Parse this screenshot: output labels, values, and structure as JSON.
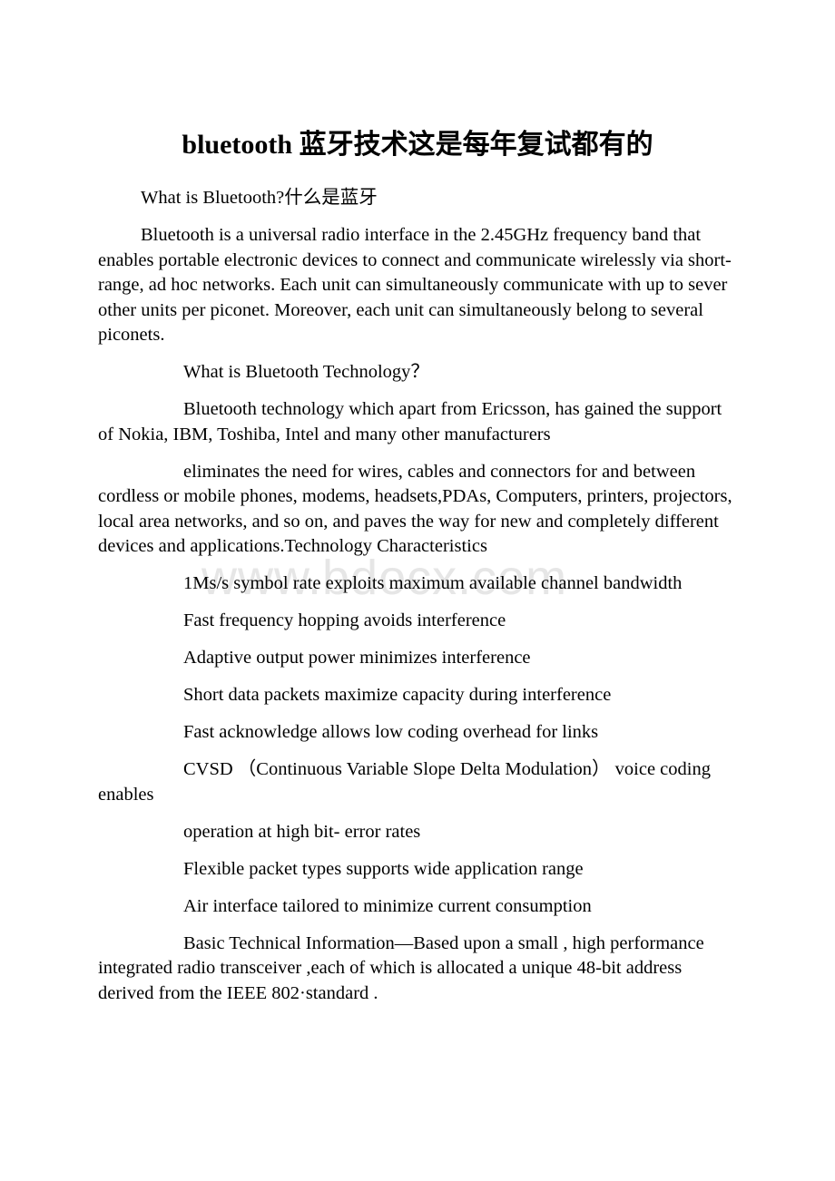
{
  "document": {
    "title": "bluetooth 蓝牙技术这是每年复试都有的",
    "watermark": "www.bdocx.com",
    "blocks": [
      {
        "id": "heading-what-is-bluetooth",
        "indent": 1,
        "text": "What is Bluetooth?什么是蓝牙"
      },
      {
        "id": "para-bluetooth-definition",
        "indent": 1,
        "text": "Bluetooth is a universal radio interface in the 2.45GHz frequency band that enables portable electronic devices to connect and communicate wirelessly via short-range, ad hoc networks. Each unit can simultaneously communicate with up to sever other units per piconet. Moreover, each unit can simultaneously belong to several piconets."
      },
      {
        "id": "heading-what-is-bluetooth-technology",
        "indent": 2,
        "text": "What is Bluetooth Technology？"
      },
      {
        "id": "para-bluetooth-support",
        "indent": 2,
        "text": "Bluetooth technology which apart from Ericsson, has gained the support of Nokia, IBM, Toshiba, Intel and many other manufacturers"
      },
      {
        "id": "para-eliminates-wires",
        "indent": 2,
        "text": "eliminates the need for wires, cables and connectors for and between cordless or mobile phones, modems, headsets,PDAs, Computers, printers, projectors, local area networks, and so on, and paves the way for new and completely different devices and applications.Technology Characteristics"
      },
      {
        "id": "para-symbol-rate",
        "indent": 2,
        "text": "1Ms/s symbol rate exploits maximum available channel bandwidth"
      },
      {
        "id": "para-frequency-hopping",
        "indent": 2,
        "text": "Fast frequency hopping avoids interference"
      },
      {
        "id": "para-adaptive-output-power",
        "indent": 2,
        "text": "Adaptive output power minimizes interference"
      },
      {
        "id": "para-short-data-packets",
        "indent": 2,
        "text": "Short data packets maximize capacity during interference"
      },
      {
        "id": "para-fast-acknowledge",
        "indent": 2,
        "text": "Fast acknowledge allows low coding overhead for links"
      },
      {
        "id": "para-cvsd",
        "indent": 2,
        "text": "CVSD （Continuous Variable Slope Delta Modulation） voice coding enables"
      },
      {
        "id": "para-operation-bit-error",
        "indent": 2,
        "text": "operation at high bit- error rates"
      },
      {
        "id": "para-flexible-packet-types",
        "indent": 2,
        "text": "Flexible packet types supports wide application range"
      },
      {
        "id": "para-air-interface",
        "indent": 2,
        "text": "Air interface tailored to minimize current consumption"
      },
      {
        "id": "para-basic-technical-information",
        "indent": 2,
        "text": "Basic Technical Information—Based upon a small , high performance integrated radio transceiver ,each of which is allocated a unique 48-bit address derived from the IEEE 802·standard ."
      }
    ]
  }
}
